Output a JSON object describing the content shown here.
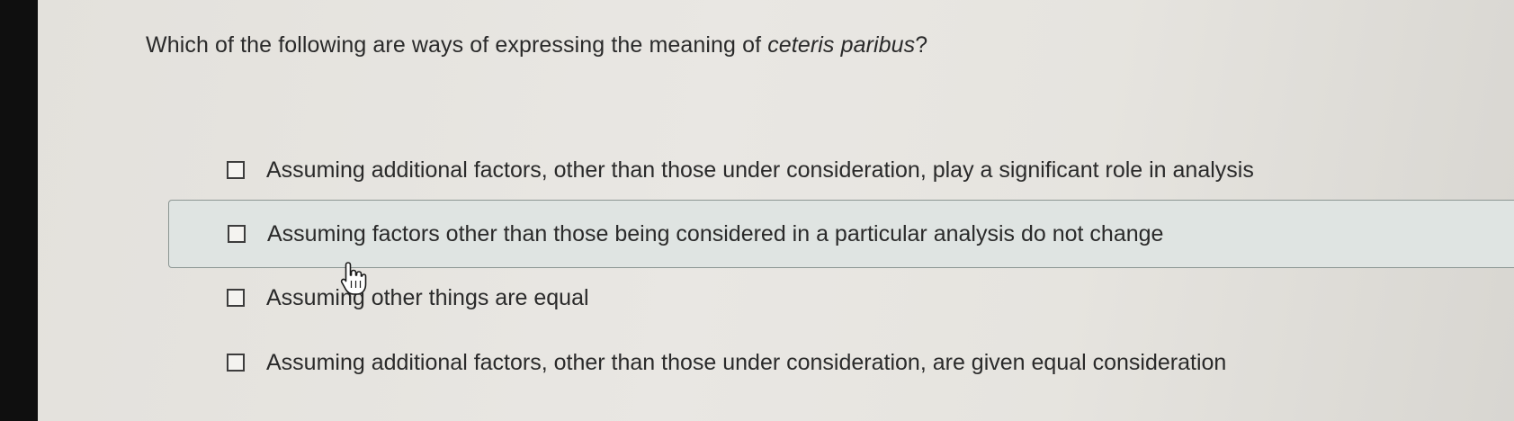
{
  "question": {
    "prefix": "Which of the following are ways of expressing the meaning of ",
    "italic_term": "ceteris paribus",
    "suffix": "?"
  },
  "options": [
    {
      "label": "Assuming additional factors, other than those under consideration, play a significant role in analysis",
      "checked": false
    },
    {
      "label": "Assuming factors other than those being considered in a particular analysis do not change",
      "checked": false,
      "hovered": true
    },
    {
      "label": "Assuming other things are equal",
      "checked": false
    },
    {
      "label": "Assuming additional factors, other than those under consideration, are given equal consideration",
      "checked": false
    }
  ],
  "colors": {
    "page_background": "#e6e4df",
    "hover_background": "#dfe4e2",
    "text": "#2a2a2a"
  },
  "icons": {
    "cursor": "hand-pointer-icon",
    "checkbox": "checkbox-empty-icon"
  }
}
